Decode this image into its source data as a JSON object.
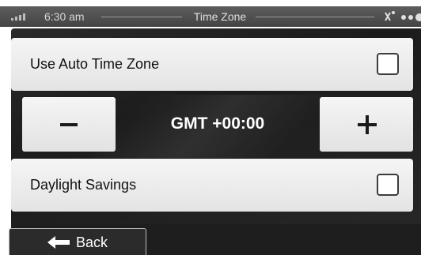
{
  "status_bar": {
    "time": "6:30 am",
    "title": "Time Zone",
    "signal_icon": "signal-strength-icon",
    "gps_icon": "gps-satellite-icon"
  },
  "auto_time_zone": {
    "label": "Use Auto Time Zone",
    "checked": false
  },
  "gmt_offset": {
    "value": "GMT +00:00",
    "decrement_icon": "minus-icon",
    "increment_icon": "plus-icon"
  },
  "daylight_savings": {
    "label": "Daylight Savings",
    "checked": false
  },
  "footer": {
    "back_label": "Back",
    "back_icon": "back-arrow-icon"
  },
  "colors": {
    "panel_background": "#1c1c1c",
    "button_background": "#eeeeee",
    "status_bar_background": "#4e4e4e",
    "text_on_dark": "#ffffff"
  }
}
